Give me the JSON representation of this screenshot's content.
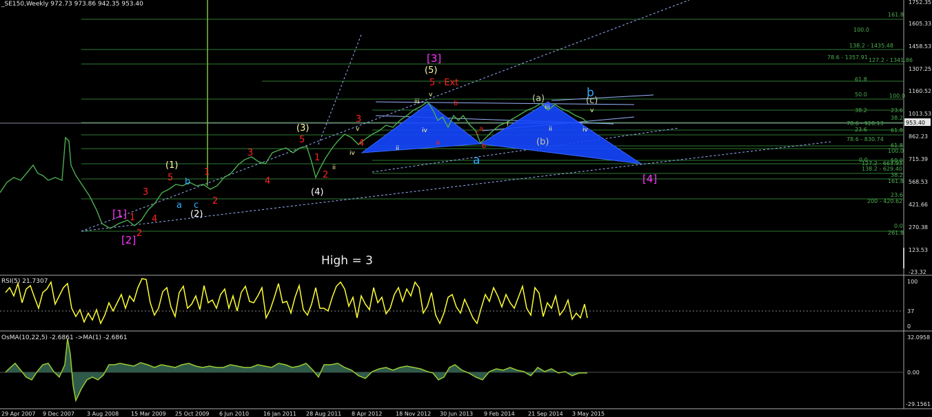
{
  "main": {
    "title": "_SE150,Weekly  972.73 973.86 942.35 953.40",
    "current_price": "953.40",
    "note": "High = 3",
    "price_axis": [
      "1752.35",
      "1605.33",
      "1458.53",
      "1307.25",
      "1160.52",
      "1013.53",
      "862.23",
      "715.39",
      "568.53",
      "421.66",
      "270.38",
      "123.53",
      "-23.32"
    ],
    "fib_labels": [
      {
        "text": "161.8",
        "color": "#4caf50"
      },
      {
        "text": "100.0",
        "color": "#4caf50"
      },
      {
        "text": "138.2 - 1435.48",
        "color": "#4caf50"
      },
      {
        "text": "78.6 - 1357.91",
        "color": "#4caf50"
      },
      {
        "text": "127.2 - 1341.86",
        "color": "#4caf50"
      },
      {
        "text": "61.8",
        "color": "#4caf50"
      },
      {
        "text": "50.0",
        "color": "#4caf50"
      },
      {
        "text": "100.0",
        "color": "#4caf50"
      },
      {
        "text": "38.2",
        "color": "#4caf50"
      },
      {
        "text": "23.6",
        "color": "#4caf50"
      },
      {
        "text": "38.2",
        "color": "#4caf50"
      },
      {
        "text": "78.6 - 928.13",
        "color": "#4caf50"
      },
      {
        "text": "23.6",
        "color": "#4caf50"
      },
      {
        "text": "61.8",
        "color": "#4caf50"
      },
      {
        "text": "78.6 - 830.74",
        "color": "#4caf50"
      },
      {
        "text": "61.8",
        "color": "#4caf50"
      },
      {
        "text": "100.0",
        "color": "#4caf50"
      },
      {
        "text": "0.0",
        "color": "#4caf50"
      },
      {
        "text": "50.0",
        "color": "#4caf50"
      },
      {
        "text": "127.2 - 663.93",
        "color": "#4caf50"
      },
      {
        "text": "138.2 - 629.40",
        "color": "#4caf50"
      },
      {
        "text": "38.2",
        "color": "#4caf50"
      },
      {
        "text": "161.8",
        "color": "#4caf50"
      },
      {
        "text": "23.6",
        "color": "#4caf50"
      },
      {
        "text": "200 - 420.62",
        "color": "#4caf50"
      },
      {
        "text": "0.0",
        "color": "#4caf50"
      },
      {
        "text": "261.8",
        "color": "#4caf50"
      }
    ],
    "wave_labels": [
      {
        "text": "[1]",
        "color": "#ff33ff"
      },
      {
        "text": "[2]",
        "color": "#ff33ff"
      },
      {
        "text": "[3]",
        "color": "#ff33ff"
      },
      {
        "text": "[4]",
        "color": "#ff33ff"
      },
      {
        "text": "(1)",
        "color": "#ffffaa"
      },
      {
        "text": "(2)",
        "color": "#ffffff"
      },
      {
        "text": "(3)",
        "color": "#ffffaa"
      },
      {
        "text": "(4)",
        "color": "#ffffff"
      },
      {
        "text": "(5)",
        "color": "#ffffaa"
      },
      {
        "text": "(a)",
        "color": "#ccccaa"
      },
      {
        "text": "(b)",
        "color": "#ccccaa"
      },
      {
        "text": "(c)",
        "color": "#ccccaa"
      },
      {
        "text": "a",
        "color": "#33aaff"
      },
      {
        "text": "b",
        "color": "#33aaff"
      },
      {
        "text": "c",
        "color": "#33aaff"
      },
      {
        "text": "a",
        "color": "#33aaff"
      },
      {
        "text": "b",
        "color": "#33aaff"
      },
      {
        "text": "1",
        "color": "#ff2222"
      },
      {
        "text": "2",
        "color": "#ff2222"
      },
      {
        "text": "3",
        "color": "#ff2222"
      },
      {
        "text": "4",
        "color": "#ff2222"
      },
      {
        "text": "5",
        "color": "#ff2222"
      },
      {
        "text": "1",
        "color": "#ff2222"
      },
      {
        "text": "2",
        "color": "#ff2222"
      },
      {
        "text": "3",
        "color": "#ff2222"
      },
      {
        "text": "4",
        "color": "#ff2222"
      },
      {
        "text": "5",
        "color": "#ff2222"
      },
      {
        "text": "1",
        "color": "#ff2222"
      },
      {
        "text": "2",
        "color": "#ff2222"
      },
      {
        "text": "3",
        "color": "#ff2222"
      },
      {
        "text": "4",
        "color": "#ff2222"
      },
      {
        "text": "5 - Ext",
        "color": "#ff2222"
      },
      {
        "text": "a",
        "color": "#ff2222"
      },
      {
        "text": "b",
        "color": "#ff2222"
      },
      {
        "text": "c",
        "color": "#ff2222"
      },
      {
        "text": "a",
        "color": "#ff2222"
      },
      {
        "text": "b",
        "color": "#ff2222"
      },
      {
        "text": "ii",
        "color": "#ffffaa"
      },
      {
        "text": "ii",
        "color": "#ffffaa"
      },
      {
        "text": "iii",
        "color": "#ffffaa"
      },
      {
        "text": "iv",
        "color": "#ffffaa"
      },
      {
        "text": "iv",
        "color": "#ffffaa"
      },
      {
        "text": "v",
        "color": "#ffffaa"
      },
      {
        "text": "v",
        "color": "#ffffaa"
      },
      {
        "text": "i",
        "color": "#ffffaa"
      },
      {
        "text": "ii",
        "color": "#ffffaa"
      },
      {
        "text": "iii",
        "color": "#ffffaa"
      },
      {
        "text": "iv",
        "color": "#ffffaa"
      },
      {
        "text": "v",
        "color": "#ffffaa"
      }
    ]
  },
  "rsi": {
    "title": "RSI(5) 21.7307",
    "axis": [
      "100",
      "37",
      "0"
    ]
  },
  "osma": {
    "title": "OsMA(10,22,5) -2.6861   ->MA(1) -2.6861",
    "axis": [
      "32.0958",
      "0.00",
      "-29.1561"
    ]
  },
  "time_axis": [
    "29 Apr 2007",
    "9 Dec 2007",
    "3 Aug 2008",
    "15 Mar 2009",
    "25 Oct 2009",
    "6 Jun 2010",
    "16 Jan 2011",
    "28 Aug 2011",
    "8 Apr 2012",
    "18 Nov 2012",
    "30 Jun 2013",
    "9 Feb 2014",
    "21 Sep 2014",
    "3 May 2015"
  ],
  "colors": {
    "background": "#000000",
    "price_line": "#4caf50",
    "fib_line": "#2e7d32",
    "pattern_fill": "#1446ff",
    "trendline": "#9ab4ff",
    "rsi_line": "#ffff33",
    "osma_fill": "#2f5a4a",
    "osma_line": "#9acd32"
  }
}
